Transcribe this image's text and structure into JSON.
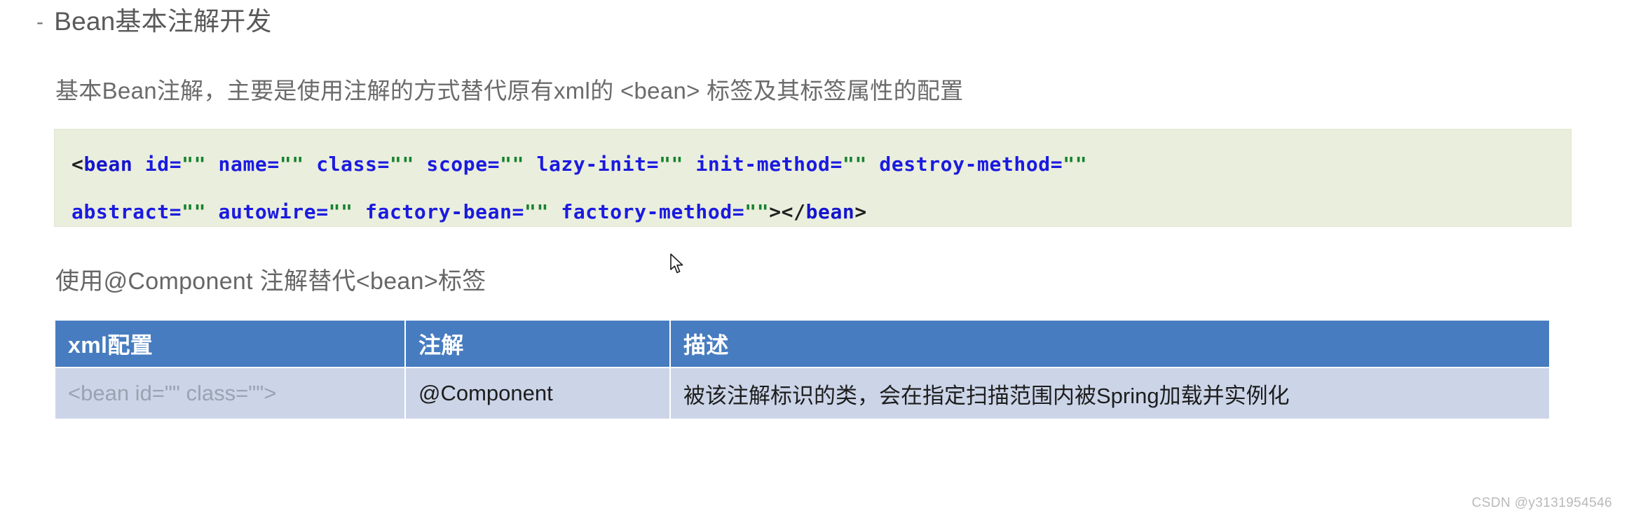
{
  "heading": {
    "bullet": "-",
    "text": "Bean基本注解开发"
  },
  "intro": {
    "text": "基本Bean注解，主要是使用注解的方式替代原有xml的 <bean> 标签及其标签属性的配置"
  },
  "code_block": {
    "language": "xml",
    "background": "#eaeedc",
    "lines": [
      {
        "tokens": [
          {
            "type": "punct",
            "text": "<"
          },
          {
            "type": "tag",
            "text": "bean"
          },
          {
            "type": "attr",
            "text": " id"
          },
          {
            "type": "eq",
            "text": "="
          },
          {
            "type": "str",
            "text": "\"\""
          },
          {
            "type": "attr",
            "text": " name"
          },
          {
            "type": "eq",
            "text": "="
          },
          {
            "type": "str",
            "text": "\"\""
          },
          {
            "type": "attr",
            "text": " class"
          },
          {
            "type": "eq",
            "text": "="
          },
          {
            "type": "str",
            "text": "\"\""
          },
          {
            "type": "attr",
            "text": " scope"
          },
          {
            "type": "eq",
            "text": "="
          },
          {
            "type": "str",
            "text": "\"\""
          },
          {
            "type": "attr",
            "text": " lazy-init"
          },
          {
            "type": "eq",
            "text": "="
          },
          {
            "type": "str",
            "text": "\"\""
          },
          {
            "type": "attr",
            "text": " init-method"
          },
          {
            "type": "eq",
            "text": "="
          },
          {
            "type": "str",
            "text": "\"\""
          },
          {
            "type": "attr",
            "text": " destroy-method"
          },
          {
            "type": "eq",
            "text": "="
          },
          {
            "type": "str",
            "text": "\"\""
          }
        ]
      },
      {
        "tokens": [
          {
            "type": "attr",
            "text": "abstract"
          },
          {
            "type": "eq",
            "text": "="
          },
          {
            "type": "str",
            "text": "\"\""
          },
          {
            "type": "attr",
            "text": " autowire"
          },
          {
            "type": "eq",
            "text": "="
          },
          {
            "type": "str",
            "text": "\"\""
          },
          {
            "type": "attr",
            "text": " factory-bean"
          },
          {
            "type": "eq",
            "text": "="
          },
          {
            "type": "str",
            "text": "\"\""
          },
          {
            "type": "attr",
            "text": " factory-method"
          },
          {
            "type": "eq",
            "text": "="
          },
          {
            "type": "str",
            "text": "\"\""
          },
          {
            "type": "punct",
            "text": "></"
          },
          {
            "type": "tag",
            "text": "bean"
          },
          {
            "type": "punct",
            "text": ">"
          }
        ]
      }
    ],
    "plain_text": "<bean id=\"\" name=\"\" class=\"\" scope=\"\" lazy-init=\"\" init-method=\"\" destroy-method=\"\" abstract=\"\" autowire=\"\" factory-bean=\"\" factory-method=\"\"></bean>"
  },
  "sub_heading": {
    "text": "使用@Component 注解替代<bean>标签"
  },
  "table": {
    "header_background": "#477cc0",
    "row_background": "#ccd5e8",
    "columns": [
      "xml配置",
      "注解",
      "描述"
    ],
    "rows": [
      {
        "xml": "<bean id=\"\" class=\"\">",
        "annotation": "@Component",
        "description": "被该注解标识的类，会在指定扫描范围内被Spring加载并实例化"
      }
    ]
  },
  "watermark": {
    "text": "CSDN @y3131954546"
  },
  "cursor": {
    "icon": "mouse-pointer"
  }
}
